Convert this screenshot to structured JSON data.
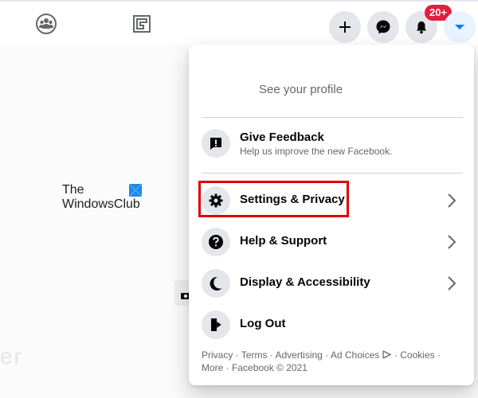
{
  "topbar": {
    "nav_icons": [
      "groups-icon",
      "gaming-icon"
    ],
    "buttons": {
      "create": "plus-icon",
      "messenger": "messenger-icon",
      "notifications": "bell-icon",
      "account": "caret-down-icon"
    },
    "notification_badge": "20+"
  },
  "background": {
    "logo_line1": "The",
    "logo_line2": "WindowsClub",
    "faded_text": "er"
  },
  "menu": {
    "profile_link": "See your profile",
    "feedback": {
      "label": "Give Feedback",
      "sublabel": "Help us improve the new Facebook."
    },
    "items": [
      {
        "label": "Settings & Privacy",
        "icon": "gear-icon",
        "has_chevron": true,
        "highlighted": true
      },
      {
        "label": "Help & Support",
        "icon": "question-icon",
        "has_chevron": true
      },
      {
        "label": "Display & Accessibility",
        "icon": "moon-icon",
        "has_chevron": true
      },
      {
        "label": "Log Out",
        "icon": "logout-icon",
        "has_chevron": false
      }
    ],
    "footer": {
      "links": [
        "Privacy",
        "Terms",
        "Advertising",
        "Ad Choices",
        "Cookies",
        "More"
      ],
      "copyright": "Facebook © 2021",
      "separator": " · "
    }
  },
  "colors": {
    "highlight_box": "#e00000",
    "badge": "#e41e3f",
    "account_active": "#1877f2"
  }
}
